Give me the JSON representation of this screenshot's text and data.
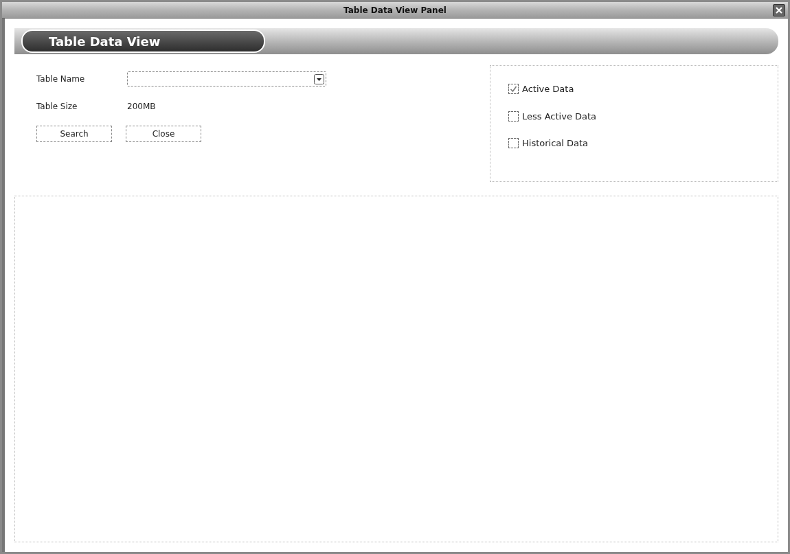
{
  "window": {
    "title": "Table Data View Panel"
  },
  "header": {
    "title": "Table Data View"
  },
  "form": {
    "fields": [
      {
        "label": "Table Name",
        "kind": "dropdown"
      },
      {
        "label": "Table Size",
        "kind": "text",
        "value": "200MB"
      }
    ],
    "buttons": [
      "Search",
      "Close"
    ]
  },
  "options": [
    {
      "label": "Active Data",
      "checked": true
    },
    {
      "label": "Less Active Data",
      "checked": false
    },
    {
      "label": "Historical Data",
      "checked": false
    }
  ]
}
